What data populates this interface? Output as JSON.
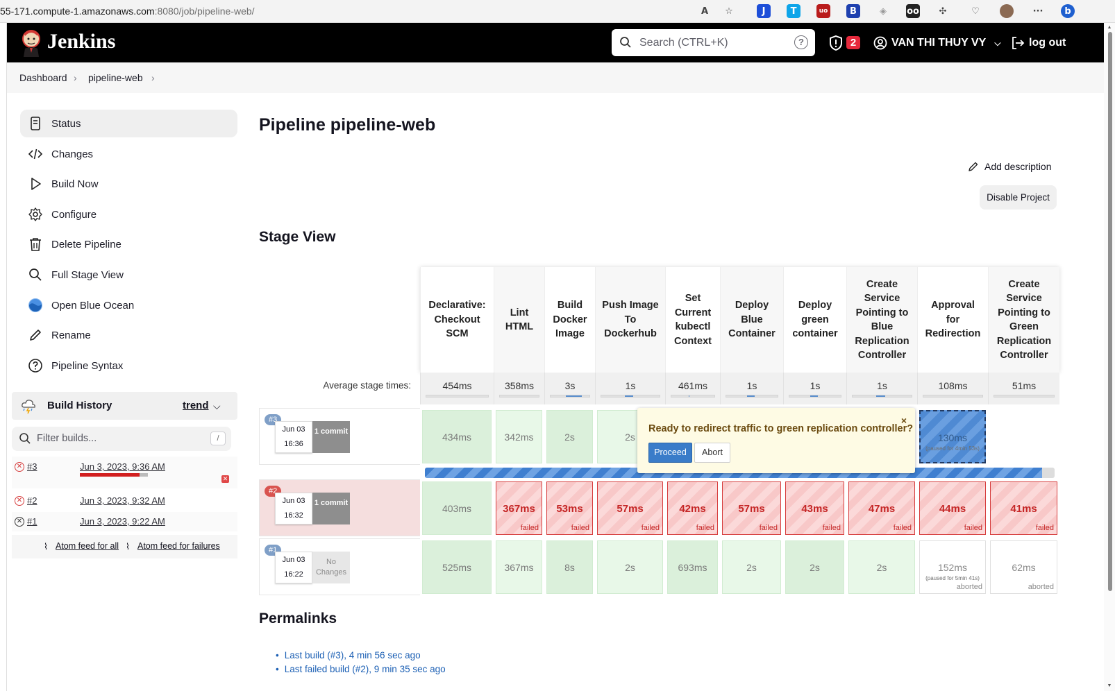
{
  "browser": {
    "url_dark": "55-171.compute-1.amazonaws.com",
    "url_dim": ":8080/job/pipeline-web/"
  },
  "header": {
    "brand": "Jenkins",
    "search_placeholder": "Search (CTRL+K)",
    "help": "?",
    "alerts": "2",
    "user": "VAN THI THUY VY",
    "logout": "log out"
  },
  "breadcrumb": {
    "items": [
      "Dashboard",
      "pipeline-web"
    ]
  },
  "sidebar": {
    "items": [
      {
        "label": "Status",
        "icon": "document-icon"
      },
      {
        "label": "Changes",
        "icon": "code-icon"
      },
      {
        "label": "Build Now",
        "icon": "play-icon"
      },
      {
        "label": "Configure",
        "icon": "gear-icon"
      },
      {
        "label": "Delete Pipeline",
        "icon": "trash-icon"
      },
      {
        "label": "Full Stage View",
        "icon": "search-icon"
      },
      {
        "label": "Open Blue Ocean",
        "icon": "blue-ocean-icon"
      },
      {
        "label": "Rename",
        "icon": "pencil-icon"
      },
      {
        "label": "Pipeline Syntax",
        "icon": "help-circle-icon"
      }
    ]
  },
  "build_history": {
    "title": "Build History",
    "trend": "trend",
    "filter_placeholder": "Filter builds...",
    "filter_key": "/",
    "builds": [
      {
        "num": "#3",
        "date": "Jun 3, 2023, 9:36 AM",
        "progress": 0.88
      },
      {
        "num": "#2",
        "date": "Jun 3, 2023, 9:32 AM"
      },
      {
        "num": "#1",
        "date": "Jun 3, 2023, 9:22 AM"
      }
    ],
    "feed_all": "Atom feed for all",
    "feed_failures": "Atom feed for failures"
  },
  "page": {
    "title": "Pipeline pipeline-web",
    "add_description": "Add description",
    "disable_project": "Disable Project",
    "stage_view_title": "Stage View",
    "avg_label": "Average stage times:"
  },
  "stage_view": {
    "stages": [
      {
        "name": "Declarative: Checkout SCM",
        "avg": "454ms",
        "avg_fill": 0.0
      },
      {
        "name": "Lint HTML",
        "avg": "358ms",
        "avg_fill": 0.0
      },
      {
        "name": "Build Docker Image",
        "avg": "3s",
        "avg_fill": 0.4
      },
      {
        "name": "Push Image To Dockerhub",
        "avg": "1s",
        "avg_fill": 0.15
      },
      {
        "name": "Set Current kubectl Context",
        "avg": "461ms",
        "avg_fill": 0.02
      },
      {
        "name": "Deploy Blue Container",
        "avg": "1s",
        "avg_fill": 0.15
      },
      {
        "name": "Deploy green container",
        "avg": "1s",
        "avg_fill": 0.15
      },
      {
        "name": "Create Service Pointing to Blue Replication Controller",
        "avg": "1s",
        "avg_fill": 0.15
      },
      {
        "name": "Approval for Redirection",
        "avg": "108ms",
        "avg_fill": 0.0
      },
      {
        "name": "Create Service Pointing to Green Replication Controller",
        "avg": "51ms",
        "avg_fill": 0.0
      }
    ],
    "builds": [
      {
        "num": "#3",
        "date": "Jun 03",
        "time": "16:36",
        "changes": "1 commit",
        "cells": [
          {
            "t": "434ms",
            "s": "ok"
          },
          {
            "t": "342ms",
            "s": "ok"
          },
          {
            "t": "2s",
            "s": "ok"
          },
          {
            "t": "2s",
            "s": "ok"
          },
          {
            "t": "",
            "s": "ok"
          },
          {
            "t": "",
            "s": "ok"
          },
          {
            "t": "",
            "s": "ok"
          },
          {
            "t": "",
            "s": "ok"
          },
          {
            "t": "130ms",
            "s": "paused",
            "note": "(paused for 4min 53s)"
          },
          {
            "t": "",
            "s": "empty"
          }
        ],
        "progress": 0.98
      },
      {
        "num": "#2",
        "date": "Jun 03",
        "time": "16:32",
        "changes": "1 commit",
        "cells": [
          {
            "t": "403ms",
            "s": "ok"
          },
          {
            "t": "367ms",
            "s": "fail",
            "f": "failed"
          },
          {
            "t": "53ms",
            "s": "fail",
            "f": "failed"
          },
          {
            "t": "57ms",
            "s": "fail",
            "f": "failed"
          },
          {
            "t": "42ms",
            "s": "fail",
            "f": "failed"
          },
          {
            "t": "57ms",
            "s": "fail",
            "f": "failed"
          },
          {
            "t": "43ms",
            "s": "fail",
            "f": "failed"
          },
          {
            "t": "47ms",
            "s": "fail",
            "f": "failed"
          },
          {
            "t": "44ms",
            "s": "fail",
            "f": "failed"
          },
          {
            "t": "41ms",
            "s": "fail",
            "f": "failed"
          }
        ]
      },
      {
        "num": "#1",
        "date": "Jun 03",
        "time": "16:22",
        "changes": "No Changes",
        "cells": [
          {
            "t": "525ms",
            "s": "ok"
          },
          {
            "t": "367ms",
            "s": "ok"
          },
          {
            "t": "8s",
            "s": "ok"
          },
          {
            "t": "2s",
            "s": "ok"
          },
          {
            "t": "693ms",
            "s": "ok"
          },
          {
            "t": "2s",
            "s": "ok"
          },
          {
            "t": "2s",
            "s": "ok"
          },
          {
            "t": "2s",
            "s": "ok"
          },
          {
            "t": "152ms",
            "s": "aborted",
            "f": "aborted",
            "note": "(paused for 5min 41s)"
          },
          {
            "t": "62ms",
            "s": "aborted",
            "f": "aborted"
          }
        ]
      }
    ],
    "popup": {
      "question": "Ready to redirect traffic to green replication controller?",
      "close": "×",
      "proceed": "Proceed",
      "abort": "Abort"
    }
  },
  "permalinks": {
    "title": "Permalinks",
    "items": [
      "Last build (#3), 4 min 56 sec ago",
      "Last failed build (#2), 9 min 35 sec ago"
    ]
  },
  "colors": {
    "header": "#000000",
    "ok": "#e8f8e8",
    "fail": "#d63c3c",
    "link": "#1b5fb4",
    "alert": "#e6293c"
  }
}
